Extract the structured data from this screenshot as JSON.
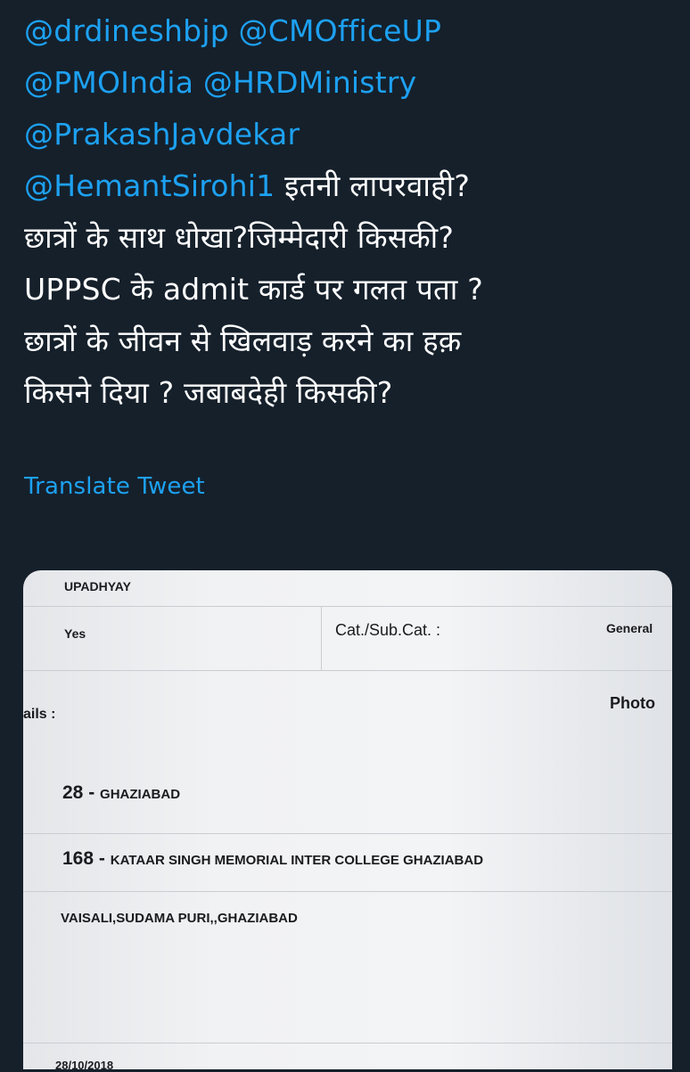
{
  "tweet": {
    "lines": [
      {
        "mention": "@drdineshbjp @CMOfficeUP",
        "text": ""
      },
      {
        "mention": "@PMOIndia @HRDMinistry",
        "text": ""
      },
      {
        "mention": "@PrakashJavdekar",
        "text": ""
      },
      {
        "mention": "@HemantSirohi1",
        "text": " इतनी लापरवाही?"
      },
      {
        "mention": "",
        "text": "छात्रों के साथ धोखा?जिम्मेदारी किसकी?"
      },
      {
        "mention": "",
        "text": "UPPSC के admit कार्ड पर गलत पता ?"
      },
      {
        "mention": "",
        "text": "छात्रों के जीवन से खिलवाड़ करने का हक़"
      },
      {
        "mention": "",
        "text": "किसने दिया ? जबाबदेही किसकी?"
      }
    ],
    "translate_label": "Translate Tweet"
  },
  "media": {
    "name": "UPADHYAY",
    "yes": "Yes",
    "cat_label": "Cat./Sub.Cat. :",
    "cat_value": "General",
    "details_label": "ails :",
    "photo_label": "Photo",
    "district": "28",
    "district_sep": "-",
    "district_name": "GHAZIABAD",
    "centre": "168",
    "centre_sep": "-",
    "centre_name": "KATAAR SINGH MEMORIAL INTER COLLEGE GHAZIABAD",
    "address": "VAISALI,SUDAMA PURI,,GHAZIABAD",
    "date": "28/10/2018"
  },
  "colors": {
    "background": "#15202b",
    "link": "#1da1f2",
    "text": "#ffffff"
  }
}
